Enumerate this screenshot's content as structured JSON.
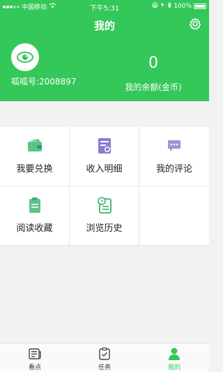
{
  "status_bar": {
    "carrier": "中国移动",
    "time": "下午5:31",
    "battery": "100%"
  },
  "header": {
    "title": "我的",
    "user_id": "呱呱号:2008897",
    "balance_value": "0",
    "balance_label": "我的余额(金币)"
  },
  "menu": {
    "items": [
      {
        "label": "我要兑换",
        "icon": "wallet-icon"
      },
      {
        "label": "收入明细",
        "icon": "income-detail-icon"
      },
      {
        "label": "我的评论",
        "icon": "comment-icon"
      },
      {
        "label": "阅读收藏",
        "icon": "bookmark-icon"
      },
      {
        "label": "浏览历史",
        "icon": "history-icon"
      }
    ]
  },
  "tabbar": {
    "tabs": [
      {
        "label": "看点",
        "icon": "news-icon"
      },
      {
        "label": "任务",
        "icon": "task-icon"
      },
      {
        "label": "我的",
        "icon": "profile-icon"
      }
    ],
    "active_index": 2
  },
  "colors": {
    "brand_green": "#34c759",
    "wallet_green": "#5cc489",
    "purple": "#8c7bd0",
    "comment_purple": "#a68fd4"
  }
}
